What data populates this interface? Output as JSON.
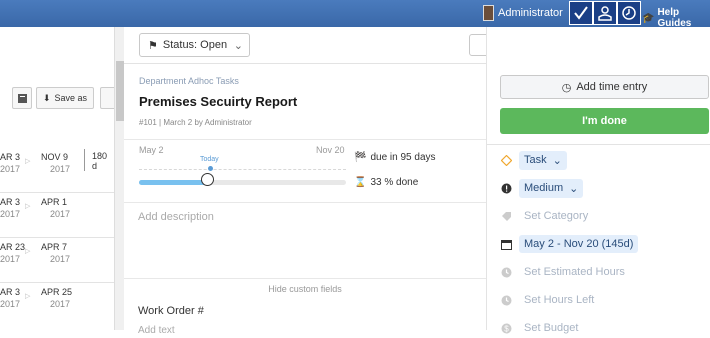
{
  "topbar": {
    "user_name": "Administrator",
    "help_label": "Help Guides",
    "buttons": [
      "check-icon",
      "user-icon",
      "clock-icon"
    ]
  },
  "left_list": {
    "save_as_label": "Save as",
    "rows": [
      {
        "start_day": "AR 3",
        "start_year": "2017",
        "end_day": "NOV 9",
        "end_year": "2017",
        "extra": "180 d"
      },
      {
        "start_day": "AR 3",
        "start_year": "2017",
        "end_day": "APR 1",
        "end_year": "2017",
        "extra": ""
      },
      {
        "start_day": "AR 23",
        "start_year": "2017",
        "end_day": "APR 7",
        "end_year": "2017",
        "extra": ""
      },
      {
        "start_day": "AR 3",
        "start_year": "2017",
        "end_day": "APR 25",
        "end_year": "2017",
        "extra": ""
      }
    ]
  },
  "task": {
    "status_label": "Status: Open",
    "department": "Department Adhoc Tasks",
    "title": "Premises Secuirty Report",
    "meta": "#101 | March 2 by Administrator",
    "date_start": "May 2",
    "date_end": "Nov 20",
    "today_label": "Today",
    "progress_percent": 33,
    "today_fraction": 0.34,
    "due_text": "due in 95 days",
    "done_text": "33 % done",
    "add_description": "Add description",
    "hide_custom_fields": "Hide custom fields",
    "work_order_label": "Work Order #",
    "work_order_placeholder": "Add text"
  },
  "sidebar": {
    "add_time_label": "Add time entry",
    "im_done_label": "I'm done",
    "type_value": "Task",
    "priority_value": "Medium",
    "category_placeholder": "Set Category",
    "date_range": "May 2 - Nov 20 (145d)",
    "estimated_hours_placeholder": "Set Estimated Hours",
    "hours_left_placeholder": "Set Hours Left",
    "budget_placeholder": "Set Budget"
  },
  "colors": {
    "topbar": "#3f70b2",
    "green": "#5cb85c",
    "accent": "#5a9bd5"
  }
}
